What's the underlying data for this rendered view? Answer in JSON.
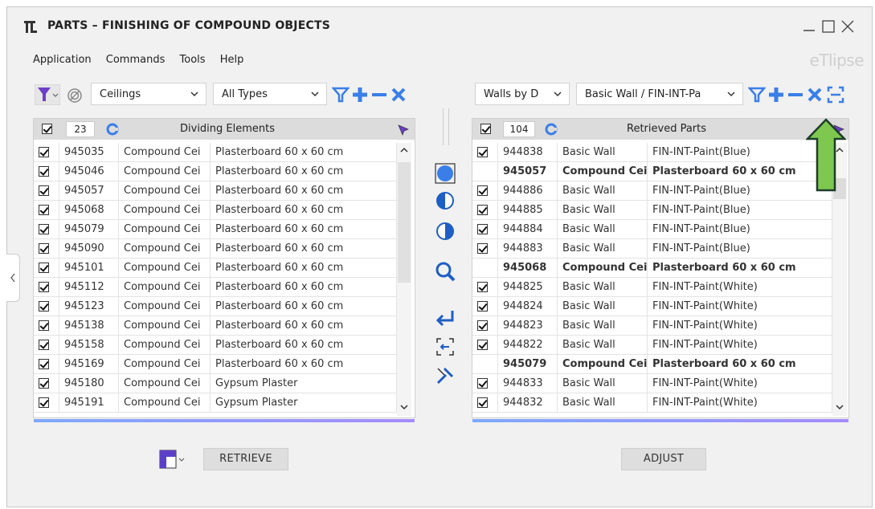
{
  "window": {
    "title": "PARTS – FINISHING OF COMPOUND OBJECTS",
    "brand": "eTlipse",
    "menu": [
      "Application",
      "Commands",
      "Tools",
      "Help"
    ]
  },
  "left": {
    "category": "Ceilings",
    "type_filter": "All Types",
    "count": "23",
    "grid_title": "Dividing Elements",
    "rows": [
      [
        "945035",
        "Compound Cei",
        "Plasterboard 60 x 60 cm"
      ],
      [
        "945046",
        "Compound Cei",
        "Plasterboard 60 x 60 cm"
      ],
      [
        "945057",
        "Compound Cei",
        "Plasterboard 60 x 60 cm"
      ],
      [
        "945068",
        "Compound Cei",
        "Plasterboard 60 x 60 cm"
      ],
      [
        "945079",
        "Compound Cei",
        "Plasterboard 60 x 60 cm"
      ],
      [
        "945090",
        "Compound Cei",
        "Plasterboard 60 x 60 cm"
      ],
      [
        "945101",
        "Compound Cei",
        "Plasterboard 60 x 60 cm"
      ],
      [
        "945112",
        "Compound Cei",
        "Plasterboard 60 x 60 cm"
      ],
      [
        "945123",
        "Compound Cei",
        "Plasterboard 60 x 60 cm"
      ],
      [
        "945138",
        "Compound Cei",
        "Plasterboard 60 x 60 cm"
      ],
      [
        "945158",
        "Compound Cei",
        "Plasterboard 60 x 60 cm"
      ],
      [
        "945169",
        "Compound Cei",
        "Plasterboard 60 x 60 cm"
      ],
      [
        "945180",
        "Compound Cei",
        "Gypsum Plaster"
      ],
      [
        "945191",
        "Compound Cei",
        "Gypsum Plaster"
      ]
    ],
    "retrieve_label": "RETRIEVE"
  },
  "right": {
    "category": "Walls by D",
    "type_filter": "Basic Wall / FIN-INT-Pa",
    "count": "104",
    "grid_title": "Retrieved Parts",
    "rows": [
      {
        "checked": true,
        "id": "944838",
        "cat": "Basic Wall",
        "name": "FIN-INT-Paint(Blue)"
      },
      {
        "checked": false,
        "id": "945057",
        "cat": "Compound Cei",
        "name": "Plasterboard 60 x 60 cm"
      },
      {
        "checked": true,
        "id": "944886",
        "cat": "Basic Wall",
        "name": "FIN-INT-Paint(Blue)"
      },
      {
        "checked": true,
        "id": "944885",
        "cat": "Basic Wall",
        "name": "FIN-INT-Paint(Blue)"
      },
      {
        "checked": true,
        "id": "944884",
        "cat": "Basic Wall",
        "name": "FIN-INT-Paint(Blue)"
      },
      {
        "checked": true,
        "id": "944883",
        "cat": "Basic Wall",
        "name": "FIN-INT-Paint(Blue)"
      },
      {
        "checked": false,
        "id": "945068",
        "cat": "Compound Cei",
        "name": "Plasterboard 60 x 60 cm"
      },
      {
        "checked": true,
        "id": "944825",
        "cat": "Basic Wall",
        "name": "FIN-INT-Paint(White)"
      },
      {
        "checked": true,
        "id": "944824",
        "cat": "Basic Wall",
        "name": "FIN-INT-Paint(White)"
      },
      {
        "checked": true,
        "id": "944823",
        "cat": "Basic Wall",
        "name": "FIN-INT-Paint(White)"
      },
      {
        "checked": true,
        "id": "944822",
        "cat": "Basic Wall",
        "name": "FIN-INT-Paint(White)"
      },
      {
        "checked": false,
        "id": "945079",
        "cat": "Compound Cei",
        "name": "Plasterboard 60 x 60 cm"
      },
      {
        "checked": true,
        "id": "944833",
        "cat": "Basic Wall",
        "name": "FIN-INT-Paint(White)"
      },
      {
        "checked": true,
        "id": "944832",
        "cat": "Basic Wall",
        "name": "FIN-INT-Paint(White)"
      }
    ],
    "adjust_label": "ADJUST"
  },
  "colors": {
    "accent_blue": "#3a7fe8",
    "filter_purple": "#6b3fc9",
    "arrow_green": "#7ec850",
    "grid_foot": "#8f9cff"
  }
}
